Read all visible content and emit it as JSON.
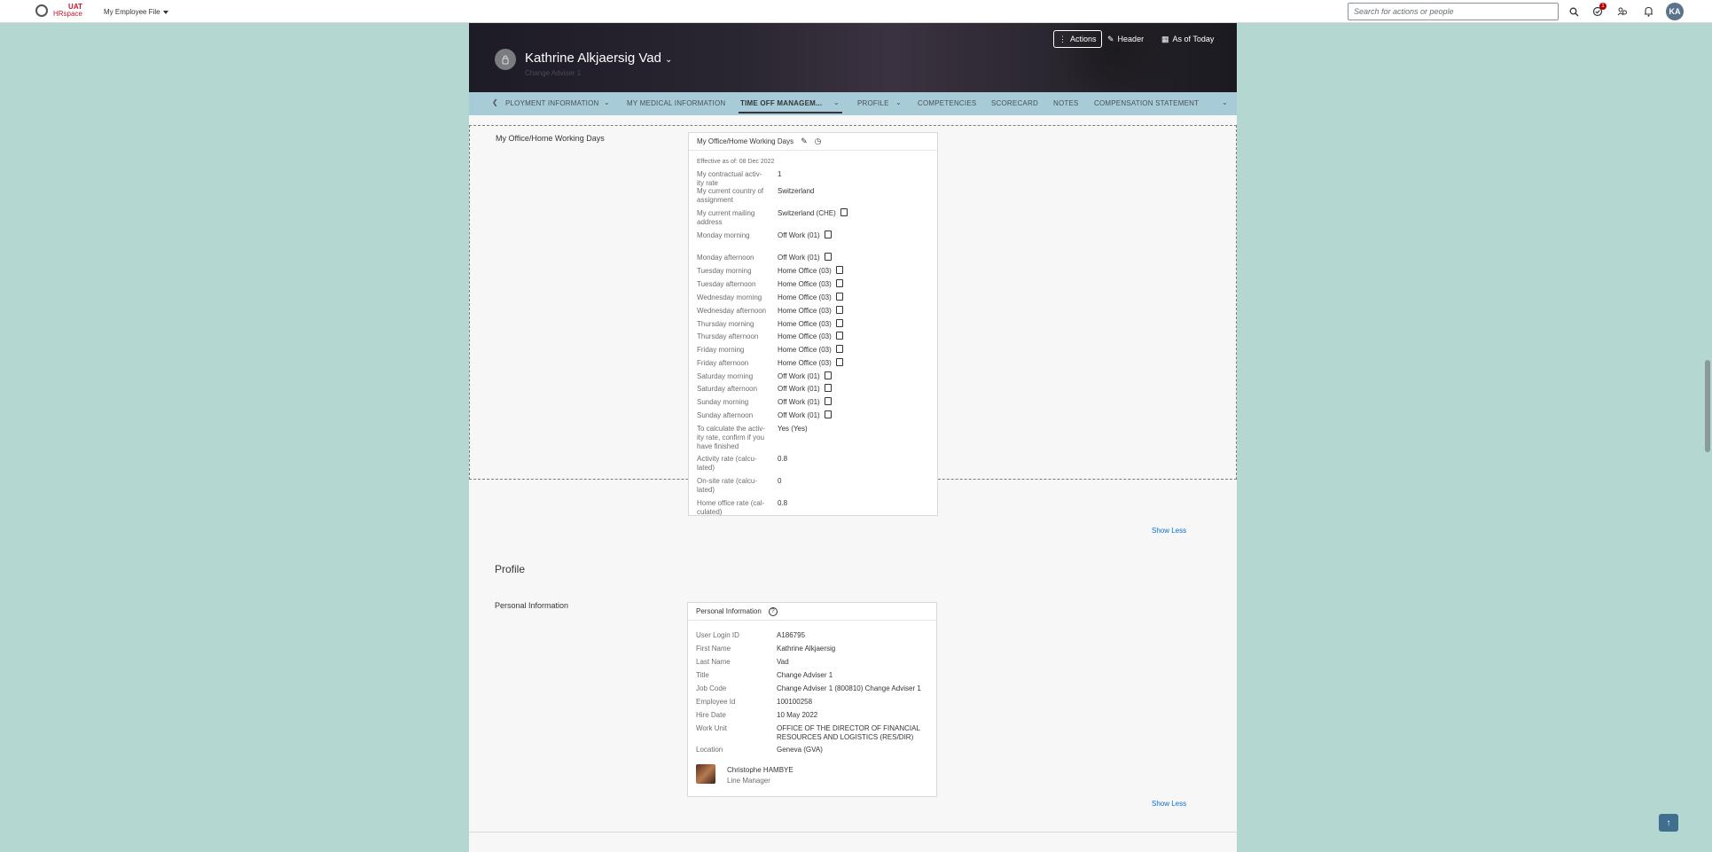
{
  "shell": {
    "logo_text": "UAT",
    "logo_sub": "HRspace",
    "app_title": "My Employee File",
    "search_placeholder": "Search for actions or people",
    "notification_count": "1",
    "avatar_initials": "KA"
  },
  "hero": {
    "name": "Kathrine Alkjaersig Vad",
    "subtitle": "Change Adviser 1",
    "actions_label": "Actions",
    "header_label": "Header",
    "as_of_label": "As of Today"
  },
  "tabs": [
    {
      "label": "PLOYMENT INFORMATION"
    },
    {
      "label": "MY MEDICAL INFORMATION"
    },
    {
      "label": "TIME OFF MANAGEM..."
    },
    {
      "label": "PROFILE"
    },
    {
      "label": "COMPETENCIES"
    },
    {
      "label": "SCORECARD"
    },
    {
      "label": "NOTES"
    },
    {
      "label": "COMPENSATION STATEMENT"
    }
  ],
  "working_days": {
    "section_label": "My Office/Home Working Days",
    "card_title": "My Office/Home Working Days",
    "effective": "Effective as of: 08 Dec 2022",
    "rows": [
      {
        "label": "My contractual activ-\nity rate",
        "value": "1"
      },
      {
        "label": "My current country of\nassignment",
        "value": "Switzerland"
      },
      {
        "label": "My current mailing\naddress",
        "value": "Switzerland (CHE)"
      },
      {
        "label": "Monday morning",
        "value": "Off Work (01)"
      },
      {
        "label": "Monday afternoon",
        "value": "Off Work (01)"
      },
      {
        "label": "Tuesday morning",
        "value": "Home Office (03)"
      },
      {
        "label": "Tuesday afternoon",
        "value": "Home Office (03)"
      },
      {
        "label": "Wednesday morning",
        "value": "Home Office (03)"
      },
      {
        "label": "Wednesday afternoon",
        "value": "Home Office (03)"
      },
      {
        "label": "Thursday morning",
        "value": "Home Office (03)"
      },
      {
        "label": "Thursday afternoon",
        "value": "Home Office (03)"
      },
      {
        "label": "Friday morning",
        "value": "Home Office (03)"
      },
      {
        "label": "Friday afternoon",
        "value": "Home Office (03)"
      },
      {
        "label": "Saturday morning",
        "value": "Off Work (01)"
      },
      {
        "label": "Saturday afternoon",
        "value": "Off Work (01)"
      },
      {
        "label": "Sunday morning",
        "value": "Off Work (01)"
      },
      {
        "label": "Sunday afternoon",
        "value": "Off Work (01)"
      },
      {
        "label": "To calculate the activ-\nity rate, confirm if you\nhave finished",
        "value": "Yes (Yes)"
      },
      {
        "label": "Activity rate (calcu-\nlated)",
        "value": "0.8"
      },
      {
        "label": "On-site rate (calcu-\nlated)",
        "value": "0"
      },
      {
        "label": "Home office rate (cal-\nculated)",
        "value": "0.8"
      }
    ],
    "show_less": "Show Less"
  },
  "profile": {
    "title": "Profile",
    "section_label": "Personal Information",
    "card_title": "Personal Information",
    "rows": [
      {
        "label": "User Login ID",
        "value": "A186795"
      },
      {
        "label": "First Name",
        "value": "Kathrine Alkjaersig"
      },
      {
        "label": "Last Name",
        "value": "Vad"
      },
      {
        "label": "Title",
        "value": "Change Adviser 1"
      },
      {
        "label": "Job Code",
        "value": "Change Adviser 1 (800810)  Change Adviser 1"
      },
      {
        "label": "Employee Id",
        "value": "100100258"
      },
      {
        "label": "Hire Date",
        "value": "10 May 2022"
      },
      {
        "label": "Work Unit",
        "value": "OFFICE OF THE DIRECTOR OF FINANCIAL\nRESOURCES AND LOGISTICS (RES/DIR)"
      },
      {
        "label": "Location",
        "value": "Geneva (GVA)"
      }
    ],
    "manager_name": "Christophe HAMBYE",
    "manager_role": "Line Manager",
    "show_less": "Show Less"
  },
  "icons": [
    "search-icon",
    "approvals-icon",
    "people-icon",
    "bell-icon",
    "pencil-icon",
    "history-icon",
    "help-icon",
    "copy-icon",
    "arrow-up-icon"
  ]
}
